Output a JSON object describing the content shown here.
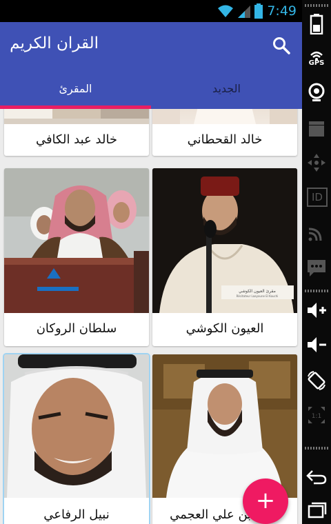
{
  "status_bar": {
    "time": "7:49",
    "wifi_icon": "wifi-icon",
    "signal_icon": "signal-icon",
    "battery_icon": "battery-icon"
  },
  "app_bar": {
    "title": "القران الكريم",
    "search_icon": "search-icon"
  },
  "tabs": [
    {
      "label": "المقرئ",
      "selected": true
    },
    {
      "label": "الجديد",
      "selected": false
    }
  ],
  "reciters": [
    {
      "name": "خالد القحطاني"
    },
    {
      "name": "خالد عبد الكافي"
    },
    {
      "name": "العيون الكوشي"
    },
    {
      "name": "سلطان الروكان"
    },
    {
      "name": "احمد بن علي العجمي",
      "partially_hidden": true
    },
    {
      "name": "نبيل الرفاعي"
    }
  ],
  "photo_caption": {
    "line1": "مقرئ العيون الكوشي",
    "line2": "Récitateur Laayoune El Kouchi"
  },
  "fab": {
    "label": "+"
  },
  "side_panel": {
    "gps_label": "GPS",
    "id_label": "ID",
    "ratio_label": "1:1"
  },
  "colors": {
    "primary": "#3f51b5",
    "accent": "#e91e63",
    "fab": "#ef1a62",
    "clock": "#33b5e5"
  }
}
